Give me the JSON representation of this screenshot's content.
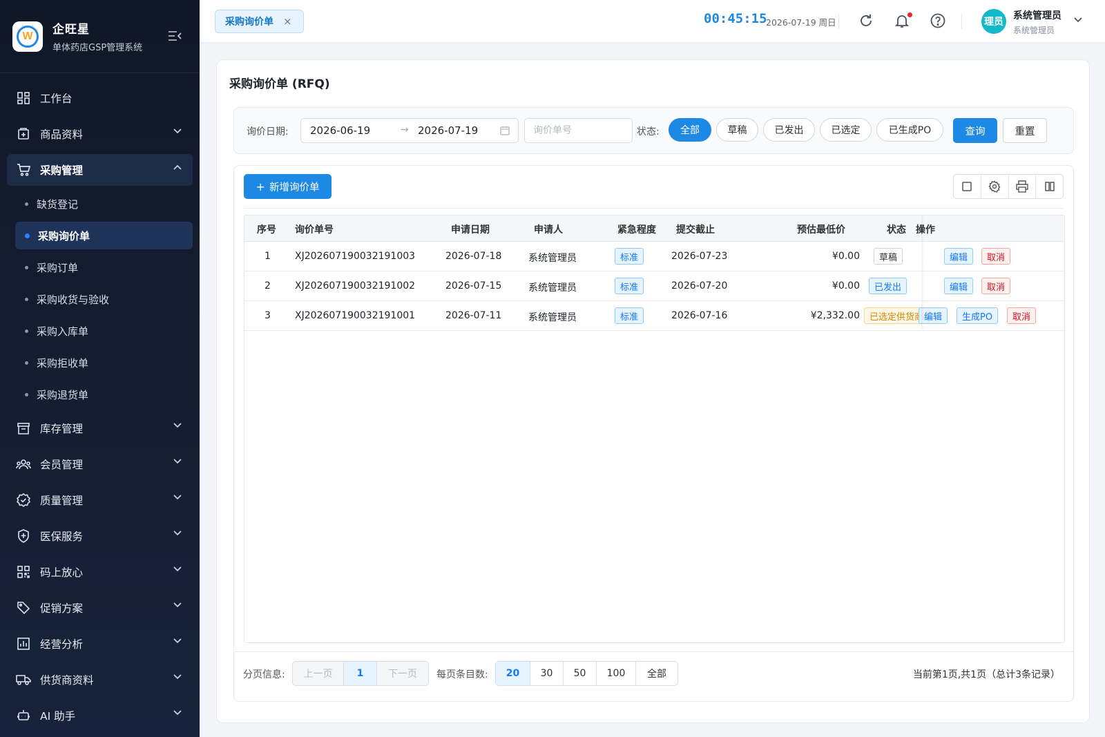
{
  "brand": {
    "name": "企旺星",
    "subtitle": "单体药店GSP管理系统",
    "logo_letter": "W"
  },
  "menu": [
    {
      "label": "工作台",
      "icon": "dashboard-icon"
    },
    {
      "label": "商品资料",
      "icon": "product-icon"
    },
    {
      "label": "采购管理",
      "icon": "cart-icon",
      "open": true,
      "children": [
        {
          "label": "缺货登记"
        },
        {
          "label": "采购询价单",
          "active": true
        },
        {
          "label": "采购订单"
        },
        {
          "label": "采购收货与验收"
        },
        {
          "label": "采购入库单"
        },
        {
          "label": "采购拒收单"
        },
        {
          "label": "采购退货单"
        }
      ]
    },
    {
      "label": "库存管理",
      "icon": "inventory-icon"
    },
    {
      "label": "会员管理",
      "icon": "members-icon"
    },
    {
      "label": "质量管理",
      "icon": "quality-icon"
    },
    {
      "label": "医保服务",
      "icon": "insurance-icon"
    },
    {
      "label": "码上放心",
      "icon": "qrcode-icon"
    },
    {
      "label": "促销方案",
      "icon": "tag-icon"
    },
    {
      "label": "经营分析",
      "icon": "analytics-icon"
    },
    {
      "label": "供货商资料",
      "icon": "truck-icon"
    },
    {
      "label": "AI 助手",
      "icon": "robot-icon"
    }
  ],
  "header": {
    "tab_label": "采购询价单",
    "tab_close": "×",
    "clock": "00:45:15",
    "date": "2026-07-19 周日",
    "avatar_text": "理员",
    "user_name": "系统管理员",
    "user_role": "系统管理员"
  },
  "page": {
    "title": "采购询价单 (RFQ)"
  },
  "filter": {
    "date_label": "询价日期:",
    "date_from": "2026-06-19",
    "date_sep": "→",
    "date_to": "2026-07-19",
    "rfq_placeholder": "询价单号",
    "status_label": "状态:",
    "status_options": [
      "全部",
      "草稿",
      "已发出",
      "已选定",
      "已生成PO"
    ],
    "status_selected": "全部",
    "query_label": "查询",
    "reset_label": "重置"
  },
  "toolbar": {
    "add_label": "新增询价单"
  },
  "table": {
    "headers": {
      "seq": "序号",
      "rfq_no": "询价单号",
      "apply_date": "申请日期",
      "applicant": "申请人",
      "urgency": "紧急程度",
      "deadline": "提交截止",
      "est_price": "预估最低价",
      "status": "状态",
      "ops": "操作"
    },
    "rows": [
      {
        "seq": "1",
        "rfq_no": "XJ202607190032191003",
        "apply_date": "2026-07-18",
        "applicant": "系统管理员",
        "urgency": "标准",
        "deadline": "2026-07-23",
        "est_price": "¥0.00",
        "status": "草稿",
        "ops": [
          "编辑",
          "取消"
        ]
      },
      {
        "seq": "2",
        "rfq_no": "XJ202607190032191002",
        "apply_date": "2026-07-15",
        "applicant": "系统管理员",
        "urgency": "标准",
        "deadline": "2026-07-20",
        "est_price": "¥0.00",
        "status": "已发出",
        "ops": [
          "编辑",
          "取消"
        ]
      },
      {
        "seq": "3",
        "rfq_no": "XJ202607190032191001",
        "apply_date": "2026-07-11",
        "applicant": "系统管理员",
        "urgency": "标准",
        "deadline": "2026-07-16",
        "est_price": "¥2,332.00",
        "status": "已选定供货商",
        "ops": [
          "编辑",
          "生成PO",
          "取消"
        ]
      }
    ]
  },
  "pager": {
    "info_label": "分页信息:",
    "prev": "上一页",
    "current": "1",
    "next": "下一页",
    "size_label": "每页条目数:",
    "sizes": [
      "20",
      "30",
      "50",
      "100",
      "全部"
    ],
    "size_selected": "20",
    "summary": "当前第1页,共1页（总计3条记录）"
  },
  "colors": {
    "accent": "#1e88e5",
    "sidebar_bg": "#101827",
    "danger": "#cf1322",
    "warning": "#d48806"
  }
}
